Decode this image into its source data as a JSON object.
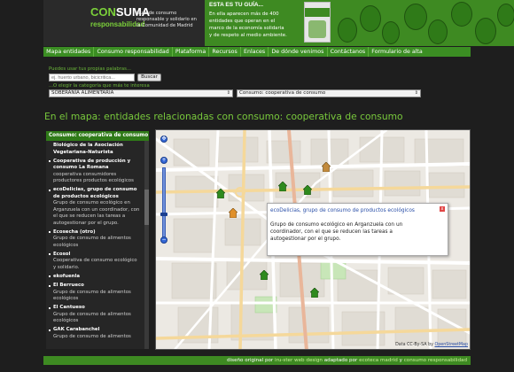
{
  "header": {
    "logo_con": "CON",
    "logo_suma": "SUMA",
    "logo_resp": "responsabilidad",
    "logo_desc": "Guía de consumo responsable y solidario en la Comunidad de Madrid",
    "promo_title": "ESTA ES TU GUÍA...",
    "promo_lines": [
      "En ella aparecen más de 400",
      "entidades que operan en el",
      "marco de la economía solidaria",
      "y de respeto al medio ambiente."
    ]
  },
  "nav": {
    "items": [
      "Mapa entidades",
      "Consumo responsabilidad",
      "Plataforma",
      "Recursos",
      "Enlaces",
      "De dónde venimos",
      "Contáctanos",
      "Formulario de alta"
    ]
  },
  "search": {
    "hint_words": "Puedes usar tus propias palabras...",
    "input_placeholder": "ej. huerto urbano, bicicritica...",
    "button_label": "Buscar",
    "hint_category": "...O elegir la categoría que más te interesa",
    "select_category": "SOBERANÍA ALIMENTARIA",
    "select_subcategory": "Consumo: cooperativa de consumo"
  },
  "page_title": "En el mapa: entidades relacionadas con consumo: cooperativa de consumo",
  "sidebar": {
    "heading": "Consumo: cooperativa de consumo",
    "items": [
      {
        "title": "Biológico de la Asociación Vegetariana-Naturista",
        "desc": "",
        "bullet": false
      },
      {
        "title": "Cooperativa de producción y consumo La Romana",
        "desc": "cooperativa consumidores productores productos ecológicos",
        "bullet": true
      },
      {
        "title": "ecoDelicias, grupo de consumo de productos ecológicos",
        "desc": "Grupo de consumo ecológico en Arganzuela con un coordinador, con el que se reducen las tareas a autogestionar por el grupo.",
        "bullet": true
      },
      {
        "title": "Ecosecha (otro)",
        "desc": "Grupo de consumo de alimentos ecológicos",
        "bullet": true
      },
      {
        "title": "Ecosol",
        "desc": "Cooperativa de consumo ecológico y solidario.",
        "bullet": true
      },
      {
        "title": "ekofuenla",
        "desc": "",
        "bullet": true
      },
      {
        "title": "El Berrueco",
        "desc": "Grupo de consumo de alimentos ecológicos",
        "bullet": true
      },
      {
        "title": "El Cantueso",
        "desc": "Grupo de consumo de alimentos ecológicos",
        "bullet": true
      },
      {
        "title": "GAK Carabanchel",
        "desc": "Grupo de consumo de alimentos",
        "bullet": true
      }
    ]
  },
  "map": {
    "popup_title": "ecoDelicias, grupo de consumo de productos ecológicos",
    "popup_close": "x",
    "popup_body": "Grupo de consumo ecológico en Arganzuela con un coordinador, con el que se reducen las tareas a autogestionar por el grupo.",
    "attribution_prefix": "Data CC-By-SA by",
    "attribution_link": "OpenStreetMap",
    "zoom_in": "+",
    "zoom_out": "−"
  },
  "footer": {
    "p1": "diseño original por ",
    "l1": "iru-ster web design",
    "p2": " adaptado por ",
    "l2": "ecoteca madrid",
    "p3": " y ",
    "l3": "consumo responsabilidad"
  },
  "colors": {
    "brand_green": "#3e8a22",
    "title_green": "#78c83c",
    "popup_link": "#2a4fa8"
  }
}
